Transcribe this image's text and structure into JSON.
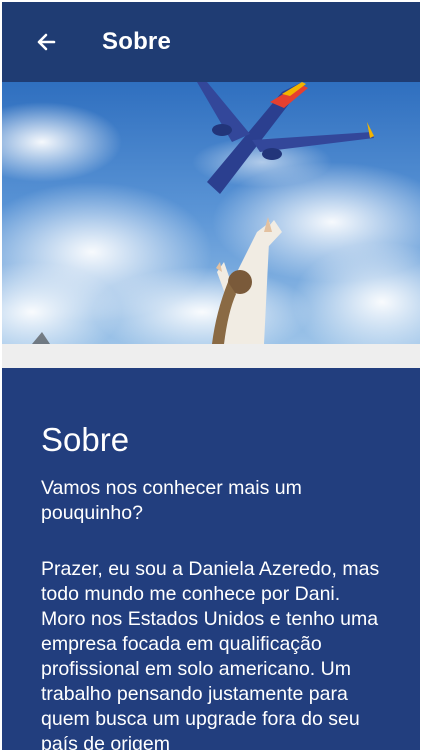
{
  "app_bar": {
    "title": "Sobre",
    "back_icon": "arrow-left-icon",
    "background": "#1f3c73"
  },
  "hero": {
    "description_icon": "hero-photo"
  },
  "content": {
    "title": "Sobre",
    "intro": "Vamos nos conhecer mais um pouquinho?",
    "body": "Prazer, eu sou a Daniela Azeredo, mas todo mundo me conhece por Dani. Moro nos Estados Unidos e tenho uma empresa focada em qualificação profissional em solo americano. Um trabalho pensando justamente para quem busca um upgrade fora do seu país de origem",
    "background": "#223e7e"
  }
}
